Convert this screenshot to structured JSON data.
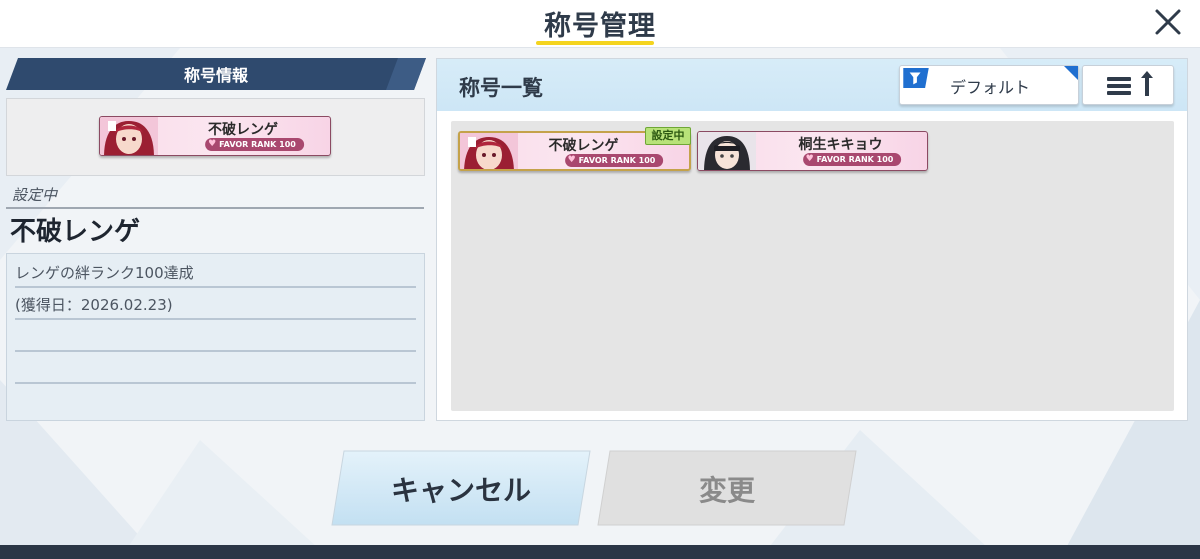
{
  "header": {
    "title": "称号管理"
  },
  "left": {
    "heading": "称号情報",
    "preview_plate": {
      "name": "不破レンゲ",
      "rank": "FAVOR RANK 100"
    },
    "current_label": "設定中",
    "current_title": "不破レンゲ",
    "description_lines": [
      "レンゲの絆ランク100達成",
      "(獲得日：2026.02.23)",
      "",
      ""
    ]
  },
  "right": {
    "heading": "称号一覧",
    "filter_label": "デフォルト",
    "titles": [
      {
        "name": "不破レンゲ",
        "rank": "FAVOR RANK 100",
        "badge": "設定中"
      },
      {
        "name": "桐生キキョウ",
        "rank": "FAVOR RANK 100"
      }
    ]
  },
  "footer": {
    "cancel_label": "キャンセル",
    "change_label": "変更"
  },
  "icons": {
    "close": "close-icon",
    "filter": "filter-icon",
    "sort": "sort-icon",
    "heart": "heart-icon"
  },
  "colors": {
    "accent_yellow": "#f4d41f",
    "heading_navy": "#2f4a6e",
    "plate_pink": "#fbe6f0",
    "rank_magenta": "#a9486f",
    "badge_green": "#b8e279"
  }
}
